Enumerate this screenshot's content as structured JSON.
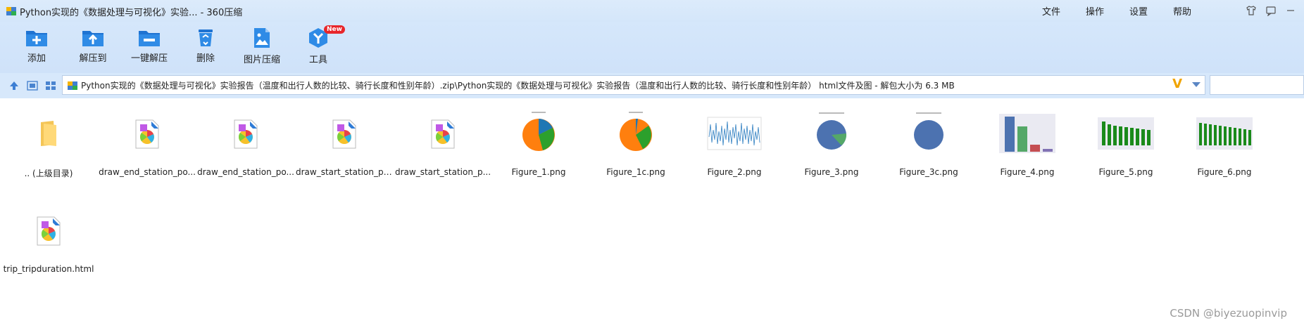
{
  "window": {
    "title": "Python实现的《数据处理与可视化》实验... - 360压缩"
  },
  "menu": [
    "文件",
    "操作",
    "设置",
    "帮助"
  ],
  "toolbar": {
    "buttons": [
      {
        "label": "添加",
        "icon": "add-folder-icon"
      },
      {
        "label": "解压到",
        "icon": "extract-to-icon"
      },
      {
        "label": "一键解压",
        "icon": "one-click-extract-icon"
      },
      {
        "label": "删除",
        "icon": "recycle-bin-icon"
      },
      {
        "label": "图片压缩",
        "icon": "image-compress-icon"
      },
      {
        "label": "工具",
        "icon": "tools-cube-icon",
        "badge": "New"
      }
    ]
  },
  "address": {
    "path": "Python实现的《数据处理与可视化》实验报告（温度和出行人数的比较、骑行长度和性别年龄）.zip\\Python实现的《数据处理与可视化》实验报告（温度和出行人数的比较、骑行长度和性别年龄） html文件及图 - 解包大小为 6.3 MB"
  },
  "files": [
    {
      "name": ".. (上级目录)",
      "kind": "parent"
    },
    {
      "name": "draw_end_station_po...",
      "kind": "html"
    },
    {
      "name": "draw_end_station_po...",
      "kind": "html"
    },
    {
      "name": "draw_start_station_po...",
      "kind": "html"
    },
    {
      "name": "draw_start_station_p...",
      "kind": "html"
    },
    {
      "name": "Figure_1.png",
      "kind": "pie1"
    },
    {
      "name": "Figure_1c.png",
      "kind": "pie1c"
    },
    {
      "name": "Figure_2.png",
      "kind": "line"
    },
    {
      "name": "Figure_3.png",
      "kind": "pie3"
    },
    {
      "name": "Figure_3c.png",
      "kind": "pie3c"
    },
    {
      "name": "Figure_4.png",
      "kind": "bar4"
    },
    {
      "name": "Figure_5.png",
      "kind": "bar5"
    },
    {
      "name": "Figure_6.png",
      "kind": "bar6"
    },
    {
      "name": "trip_tripduration.html",
      "kind": "html"
    }
  ],
  "watermark": "CSDN @biyezuopinvip",
  "colors": {
    "titlebar": "#dcebfb",
    "toolbar": "#d2e5fa",
    "accent": "#2e7bd6"
  }
}
